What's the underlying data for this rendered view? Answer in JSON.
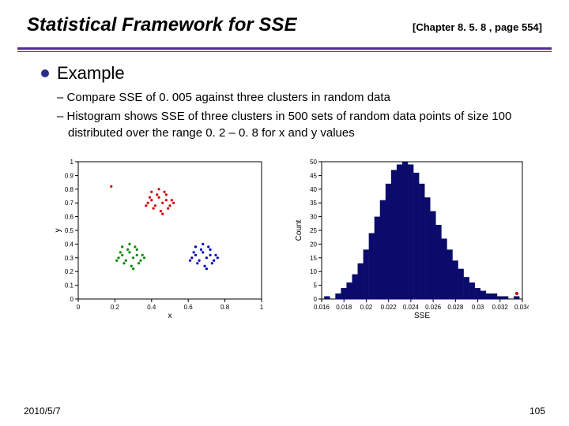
{
  "header": {
    "title": "Statistical Framework for SSE",
    "chapter_ref": "[Chapter 8. 5. 8 ,  page 554]"
  },
  "body": {
    "heading": "Example",
    "bullets": [
      "Compare SSE of 0. 005 against three clusters in random data",
      "Histogram shows SSE of three clusters in 500 sets of random data points of size 100 distributed over the range 0. 2 – 0. 8 for x and y values"
    ]
  },
  "footer": {
    "date": "2010/5/7",
    "page": "105"
  },
  "chart_data": [
    {
      "type": "scatter",
      "title": "",
      "xlabel": "x",
      "ylabel": "y",
      "xlim": [
        0,
        1
      ],
      "ylim": [
        0,
        1
      ],
      "xticks": [
        0,
        0.2,
        0.4,
        0.6,
        0.8,
        1
      ],
      "yticks": [
        0,
        0.1,
        0.2,
        0.3,
        0.4,
        0.5,
        0.6,
        0.7,
        0.8,
        0.9,
        1
      ],
      "series": [
        {
          "name": "cluster-red",
          "color": "#d00000",
          "points": [
            [
              0.38,
              0.7
            ],
            [
              0.4,
              0.72
            ],
            [
              0.42,
              0.68
            ],
            [
              0.44,
              0.74
            ],
            [
              0.46,
              0.7
            ],
            [
              0.48,
              0.72
            ],
            [
              0.5,
              0.68
            ],
            [
              0.41,
              0.66
            ],
            [
              0.43,
              0.76
            ],
            [
              0.45,
              0.64
            ],
            [
              0.47,
              0.78
            ],
            [
              0.39,
              0.74
            ],
            [
              0.51,
              0.72
            ],
            [
              0.49,
              0.66
            ],
            [
              0.37,
              0.68
            ],
            [
              0.52,
              0.7
            ],
            [
              0.44,
              0.8
            ],
            [
              0.46,
              0.62
            ],
            [
              0.4,
              0.78
            ],
            [
              0.48,
              0.76
            ]
          ]
        },
        {
          "name": "cluster-green",
          "color": "#008a00",
          "points": [
            [
              0.22,
              0.3
            ],
            [
              0.24,
              0.32
            ],
            [
              0.26,
              0.28
            ],
            [
              0.28,
              0.34
            ],
            [
              0.3,
              0.3
            ],
            [
              0.32,
              0.32
            ],
            [
              0.34,
              0.28
            ],
            [
              0.25,
              0.26
            ],
            [
              0.27,
              0.36
            ],
            [
              0.29,
              0.24
            ],
            [
              0.31,
              0.38
            ],
            [
              0.23,
              0.34
            ],
            [
              0.35,
              0.32
            ],
            [
              0.33,
              0.26
            ],
            [
              0.21,
              0.28
            ],
            [
              0.36,
              0.3
            ],
            [
              0.28,
              0.4
            ],
            [
              0.3,
              0.22
            ],
            [
              0.24,
              0.38
            ],
            [
              0.32,
              0.36
            ]
          ]
        },
        {
          "name": "cluster-blue",
          "color": "#0000c0",
          "points": [
            [
              0.62,
              0.3
            ],
            [
              0.64,
              0.32
            ],
            [
              0.66,
              0.28
            ],
            [
              0.68,
              0.34
            ],
            [
              0.7,
              0.3
            ],
            [
              0.72,
              0.32
            ],
            [
              0.74,
              0.28
            ],
            [
              0.65,
              0.26
            ],
            [
              0.67,
              0.36
            ],
            [
              0.69,
              0.24
            ],
            [
              0.71,
              0.38
            ],
            [
              0.63,
              0.34
            ],
            [
              0.75,
              0.32
            ],
            [
              0.73,
              0.26
            ],
            [
              0.61,
              0.28
            ],
            [
              0.76,
              0.3
            ],
            [
              0.68,
              0.4
            ],
            [
              0.7,
              0.22
            ],
            [
              0.64,
              0.38
            ],
            [
              0.72,
              0.36
            ]
          ]
        }
      ]
    },
    {
      "type": "bar",
      "title": "",
      "xlabel": "SSE",
      "ylabel": "Count",
      "xlim": [
        0.016,
        0.034
      ],
      "ylim": [
        0,
        50
      ],
      "xticks": [
        0.016,
        0.018,
        0.02,
        0.022,
        0.024,
        0.026,
        0.028,
        0.03,
        0.032,
        0.034
      ],
      "yticks": [
        0,
        5,
        10,
        15,
        20,
        25,
        30,
        35,
        40,
        45,
        50
      ],
      "categories": [
        0.0165,
        0.0175,
        0.018,
        0.0185,
        0.019,
        0.0195,
        0.02,
        0.0205,
        0.021,
        0.0215,
        0.022,
        0.0225,
        0.023,
        0.0235,
        0.024,
        0.0245,
        0.025,
        0.0255,
        0.026,
        0.0265,
        0.027,
        0.0275,
        0.028,
        0.0285,
        0.029,
        0.0295,
        0.03,
        0.0305,
        0.031,
        0.0315,
        0.032,
        0.0325,
        0.0335
      ],
      "values": [
        1,
        2,
        4,
        6,
        9,
        13,
        18,
        24,
        30,
        36,
        42,
        47,
        49,
        50,
        49,
        46,
        42,
        37,
        32,
        27,
        22,
        18,
        14,
        11,
        8,
        6,
        4,
        3,
        2,
        2,
        1,
        1,
        1
      ]
    }
  ]
}
